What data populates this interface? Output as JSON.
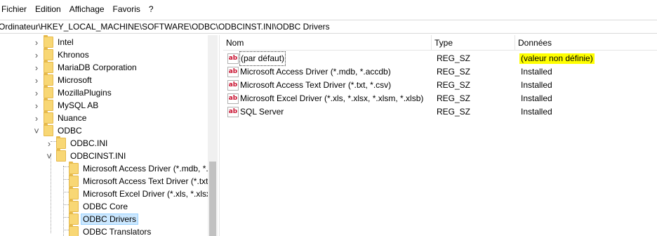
{
  "menu": [
    "Fichier",
    "Edition",
    "Affichage",
    "Favoris",
    "?"
  ],
  "address": "Ordinateur\\HKEY_LOCAL_MACHINE\\SOFTWARE\\ODBC\\ODBCINST.INI\\ODBC Drivers",
  "tree": {
    "items": [
      {
        "label": "Intel",
        "level": 1,
        "expander": ">"
      },
      {
        "label": "Khronos",
        "level": 1,
        "expander": ">"
      },
      {
        "label": "MariaDB Corporation",
        "level": 1,
        "expander": ">"
      },
      {
        "label": "Microsoft",
        "level": 1,
        "expander": ">"
      },
      {
        "label": "MozillaPlugins",
        "level": 1,
        "expander": ">"
      },
      {
        "label": "MySQL AB",
        "level": 1,
        "expander": ">"
      },
      {
        "label": "Nuance",
        "level": 1,
        "expander": ">"
      },
      {
        "label": "ODBC",
        "level": 1,
        "expander": "v"
      },
      {
        "label": "ODBC.INI",
        "level": 2,
        "expander": ">"
      },
      {
        "label": "ODBCINST.INI",
        "level": 2,
        "expander": "v"
      },
      {
        "label": "Microsoft Access Driver (*.mdb, *.a",
        "level": 3,
        "expander": ""
      },
      {
        "label": "Microsoft Access Text Driver (*.txt,",
        "level": 3,
        "expander": ""
      },
      {
        "label": "Microsoft Excel Driver (*.xls, *.xlsx,",
        "level": 3,
        "expander": ""
      },
      {
        "label": "ODBC Core",
        "level": 3,
        "expander": ""
      },
      {
        "label": "ODBC Drivers",
        "level": 3,
        "expander": "",
        "selected": true
      },
      {
        "label": "ODBC Translators",
        "level": 3,
        "expander": ""
      }
    ]
  },
  "list": {
    "headers": {
      "name": "Nom",
      "type": "Type",
      "data": "Données"
    },
    "icon_name": "string-value-icon",
    "icon_glyph": "ab",
    "rows": [
      {
        "name": "(par défaut)",
        "type": "REG_SZ",
        "data": "(valeur non définie)",
        "highlight": true,
        "selected": true
      },
      {
        "name": "Microsoft Access Driver (*.mdb, *.accdb)",
        "type": "REG_SZ",
        "data": "Installed"
      },
      {
        "name": "Microsoft Access Text Driver (*.txt, *.csv)",
        "type": "REG_SZ",
        "data": "Installed"
      },
      {
        "name": "Microsoft Excel Driver (*.xls, *.xlsx, *.xlsm, *.xlsb)",
        "type": "REG_SZ",
        "data": "Installed"
      },
      {
        "name": "SQL Server",
        "type": "REG_SZ",
        "data": "Installed"
      }
    ]
  },
  "colors": {
    "highlight": "#ffff00",
    "selection": "#cce8ff",
    "folder": "#f8d775",
    "icon_text": "#c8102e"
  }
}
